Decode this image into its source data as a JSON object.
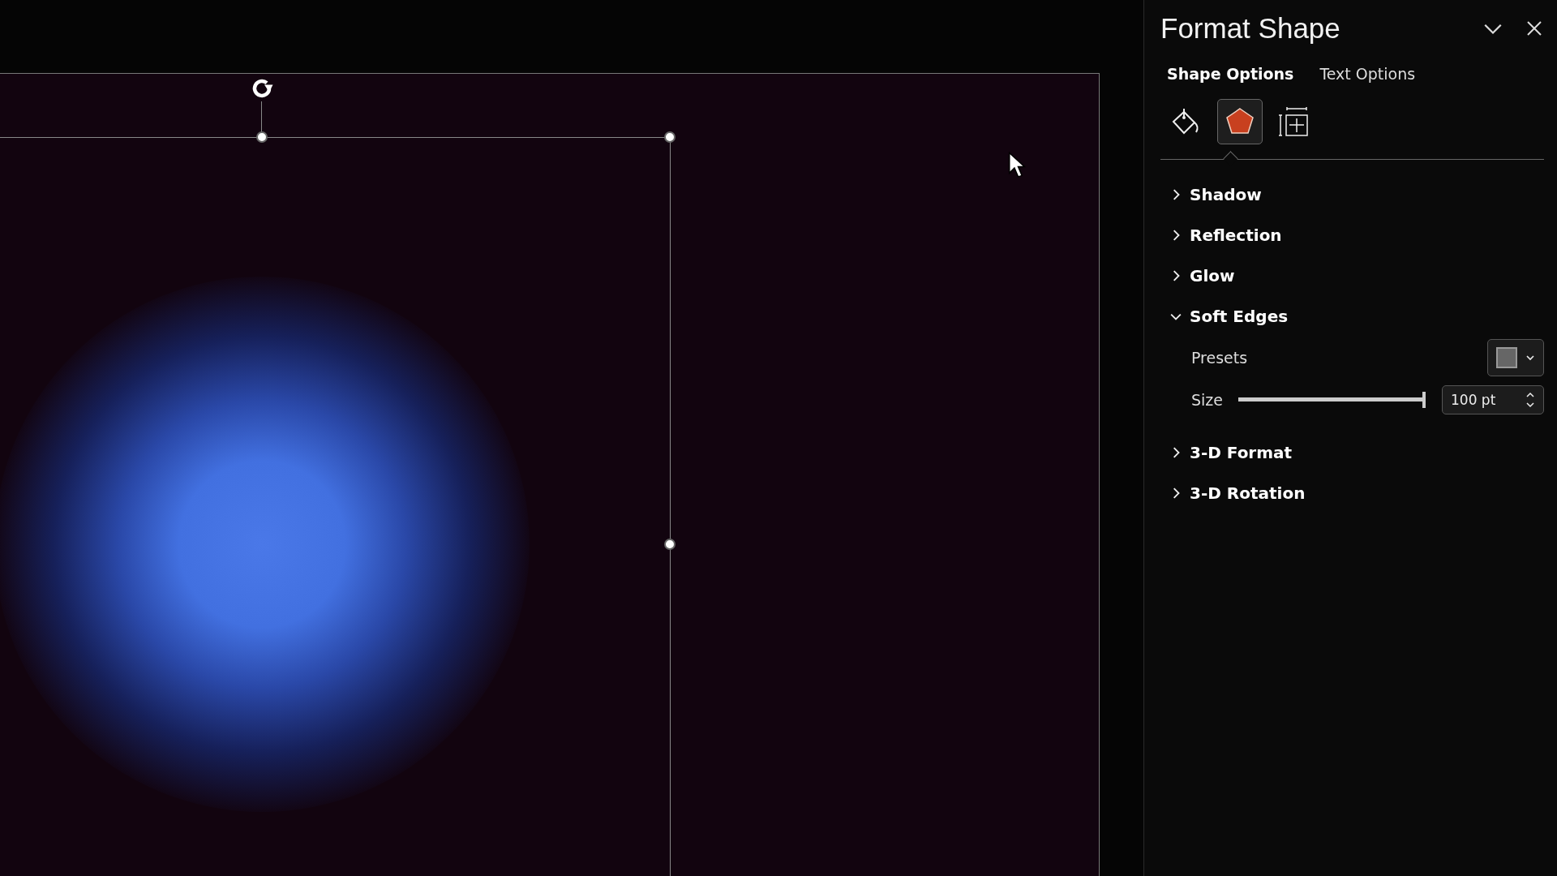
{
  "panel": {
    "title": "Format Shape",
    "tabs": [
      {
        "label": "Shape Options",
        "selected": true
      },
      {
        "label": "Text Options",
        "selected": false
      }
    ],
    "icon_tabs": [
      {
        "kind": "fill",
        "selected": false
      },
      {
        "kind": "effects",
        "selected": true
      },
      {
        "kind": "size",
        "selected": false
      }
    ],
    "sections": [
      {
        "label": "Shadow",
        "expanded": false
      },
      {
        "label": "Reflection",
        "expanded": false
      },
      {
        "label": "Glow",
        "expanded": false
      },
      {
        "label": "Soft Edges",
        "expanded": true,
        "presets": {
          "label": "Presets"
        },
        "size": {
          "label": "Size",
          "level": 1,
          "value": "100 pt"
        }
      },
      {
        "label": "3-D Format",
        "expanded": false
      },
      {
        "label": "3-D Rotation",
        "expanded": false
      }
    ]
  }
}
